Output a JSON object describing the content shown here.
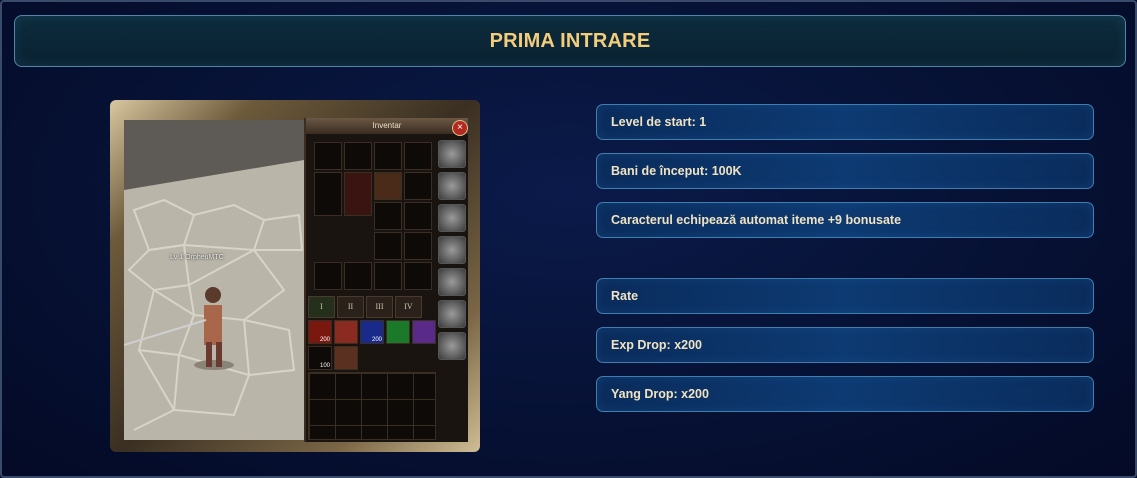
{
  "header": {
    "title": "PRIMA INTRARE"
  },
  "game_screenshot": {
    "inventory_title": "Inventar",
    "close_label": "×",
    "character_label": "Lv 1 OrpheuMTC",
    "inventory_tabs": [
      "I",
      "II",
      "III",
      "IV"
    ],
    "item_counts": [
      "200",
      "200",
      "100"
    ]
  },
  "info_start": [
    {
      "label": "Level de start: 1"
    },
    {
      "label": "Bani de început: 100K"
    },
    {
      "label": "Caracterul echipează automat iteme +9 bonusate"
    }
  ],
  "info_rates": [
    {
      "label": "Rate"
    },
    {
      "label": "Exp Drop: x200"
    },
    {
      "label": "Yang Drop: x200"
    }
  ],
  "colors": {
    "title": "#f3cd7a",
    "text": "#f1e3c2",
    "border": "#3f7fb0"
  }
}
